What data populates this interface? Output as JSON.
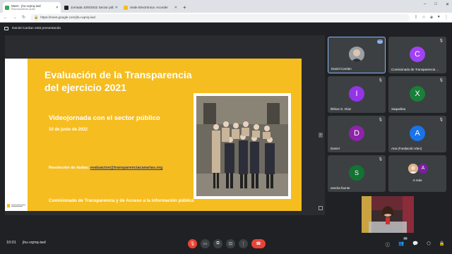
{
  "browser": {
    "tabs": [
      {
        "title": "Meet - jhu-vqmq-iwd",
        "subtitle": "Reproduciendo audio",
        "favicon_color": "#34a853",
        "active": true
      },
      {
        "title": "Jornada 10/6/2022 Sector públ...",
        "favicon_color": "#202124",
        "active": false
      },
      {
        "title": "Sede Electrónica: Acceder",
        "favicon_color": "#f5bd1f",
        "active": false
      }
    ],
    "new_tab": "+",
    "window_controls": [
      "–",
      "□",
      "✕"
    ],
    "url": "https://meet.google.com/jhu-vqmq-iwd",
    "icons": [
      "back-icon",
      "forward-icon",
      "reload-icon",
      "share-icon",
      "star-icon",
      "extension-icon",
      "profile-icon",
      "menu-icon"
    ]
  },
  "meet": {
    "presenting_text": "Daniel Cardan está presentando",
    "slide": {
      "title_line1": "Evaluación de la Transparencia",
      "title_line2": "del ejercicio 2021",
      "subtitle": "Videojornada con el sector público",
      "date": "10 de junio de 2022",
      "contact_label": "Resolución de dudas:",
      "contact_email": "evaluacion@transparenciacanarias.org",
      "footer": "Comisionado de Transparencia y de Acceso a la información pública",
      "bg_color": "#f5bd1f"
    },
    "participants": [
      {
        "name": "Daniel Cardan",
        "initial": "",
        "color": "#6b6e73",
        "photo": true,
        "active": true
      },
      {
        "name": "Comisionado de Transparencia ...",
        "initial": "C",
        "color": "#a142f4"
      },
      {
        "name": "Ilithios G. Díaz",
        "initial": "I",
        "color": "#9334e6"
      },
      {
        "name": "Xaquelina",
        "initial": "X",
        "color": "#188038"
      },
      {
        "name": "Daniel",
        "initial": "D",
        "color": "#8e24aa"
      },
      {
        "name": "Ana (Fundación Ideo)",
        "initial": "A",
        "color": "#1a73e8"
      },
      {
        "name": "sandra faonte",
        "initial": "S",
        "color": "#137333"
      }
    ],
    "more_tile": {
      "label": "4 más",
      "initial": "A",
      "color": "#7b1fa2"
    },
    "bottom": {
      "time": "10:01",
      "meeting_code": "jhu-vqmq-iwd",
      "participant_count": "15"
    }
  }
}
